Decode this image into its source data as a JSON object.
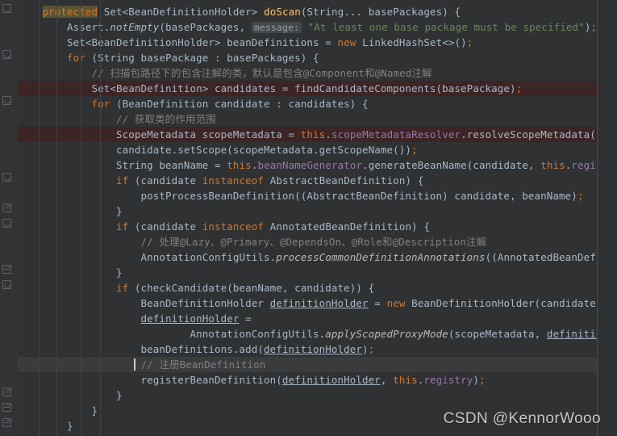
{
  "editor": {
    "theme": "darcula",
    "background": "#2f3133",
    "gutter_background": "#313335",
    "default_text_color": "#a9b7c6",
    "error_line_color": "#3d2425",
    "caret_line_color": "#393b3d",
    "selection_color": "#5b5332",
    "language": "Java",
    "parameter_hint": "message:"
  },
  "watermark": {
    "text": "CSDN @KennorWooo"
  },
  "code": {
    "lines": [
      {
        "id": "line-1",
        "indent": 1,
        "text": "protected Set<BeanDefinitionHolder> doScan(String... basePackages) {",
        "highlight": "none",
        "fold": "collapse"
      },
      {
        "id": "line-2",
        "indent": 2,
        "text": "Assert.notEmpty(basePackages, message: \"At least one base package must be specified\");",
        "highlight": "none",
        "fold": "none"
      },
      {
        "id": "line-3",
        "indent": 2,
        "text": "Set<BeanDefinitionHolder> beanDefinitions = new LinkedHashSet<>();",
        "highlight": "none",
        "fold": "none"
      },
      {
        "id": "line-4",
        "indent": 2,
        "text": "for (String basePackage : basePackages) {",
        "highlight": "none",
        "fold": "collapse"
      },
      {
        "id": "line-5",
        "indent": 3,
        "text": "// 扫描包路径下的包含注解的类，默认是包含@Component和@Named注解",
        "highlight": "none",
        "fold": "none"
      },
      {
        "id": "line-6",
        "indent": 3,
        "text": "Set<BeanDefinition> candidates = findCandidateComponents(basePackage);",
        "highlight": "error",
        "fold": "none"
      },
      {
        "id": "line-7",
        "indent": 3,
        "text": "for (BeanDefinition candidate : candidates) {",
        "highlight": "none",
        "fold": "collapse"
      },
      {
        "id": "line-8",
        "indent": 4,
        "text": "// 获取类的作用范围",
        "highlight": "none",
        "fold": "none"
      },
      {
        "id": "line-9",
        "indent": 4,
        "text": "ScopeMetadata scopeMetadata = this.scopeMetadataResolver.resolveScopeMetadata(candidate);",
        "highlight": "error",
        "fold": "none"
      },
      {
        "id": "line-10",
        "indent": 4,
        "text": "candidate.setScope(scopeMetadata.getScopeName());",
        "highlight": "none",
        "fold": "none"
      },
      {
        "id": "line-11",
        "indent": 4,
        "text": "String beanName = this.beanNameGenerator.generateBeanName(candidate, this.registry);",
        "highlight": "none",
        "fold": "none"
      },
      {
        "id": "line-12",
        "indent": 4,
        "text": "if (candidate instanceof AbstractBeanDefinition) {",
        "highlight": "none",
        "fold": "collapse"
      },
      {
        "id": "line-13",
        "indent": 5,
        "text": "postProcessBeanDefinition((AbstractBeanDefinition) candidate, beanName);",
        "highlight": "none",
        "fold": "none"
      },
      {
        "id": "line-14",
        "indent": 4,
        "text": "}",
        "highlight": "none",
        "fold": "expand"
      },
      {
        "id": "line-15",
        "indent": 4,
        "text": "if (candidate instanceof AnnotatedBeanDefinition) {",
        "highlight": "none",
        "fold": "collapse"
      },
      {
        "id": "line-16",
        "indent": 5,
        "text": "// 处理@Lazy、@Primary、@DependsOn、@Role和@Description注解",
        "highlight": "none",
        "fold": "none"
      },
      {
        "id": "line-17",
        "indent": 5,
        "text": "AnnotationConfigUtils.processCommonDefinitionAnnotations((AnnotatedBeanDefinition) candidate);",
        "highlight": "none",
        "fold": "none"
      },
      {
        "id": "line-18",
        "indent": 4,
        "text": "}",
        "highlight": "none",
        "fold": "expand"
      },
      {
        "id": "line-19",
        "indent": 4,
        "text": "if (checkCandidate(beanName, candidate)) {",
        "highlight": "none",
        "fold": "collapse"
      },
      {
        "id": "line-20",
        "indent": 5,
        "text": "BeanDefinitionHolder definitionHolder = new BeanDefinitionHolder(candidate, beanName);",
        "highlight": "none",
        "fold": "none"
      },
      {
        "id": "line-21",
        "indent": 5,
        "text": "definitionHolder =",
        "highlight": "none",
        "fold": "none"
      },
      {
        "id": "line-22",
        "indent": 7,
        "text": "AnnotationConfigUtils.applyScopedProxyMode(scopeMetadata, definitionHolder, this.registry);",
        "highlight": "none",
        "fold": "none"
      },
      {
        "id": "line-23",
        "indent": 5,
        "text": "beanDefinitions.add(definitionHolder);",
        "highlight": "none",
        "fold": "none"
      },
      {
        "id": "line-24",
        "indent": 5,
        "text": "// 注册BeanDefinition",
        "highlight": "caret",
        "fold": "none"
      },
      {
        "id": "line-25",
        "indent": 5,
        "text": "registerBeanDefinition(definitionHolder, this.registry);",
        "highlight": "none",
        "fold": "none"
      },
      {
        "id": "line-26",
        "indent": 4,
        "text": "}",
        "highlight": "none",
        "fold": "expand"
      },
      {
        "id": "line-27",
        "indent": 3,
        "text": "}",
        "highlight": "none",
        "fold": "expand"
      },
      {
        "id": "line-28",
        "indent": 2,
        "text": "}",
        "highlight": "none",
        "fold": "expand"
      },
      {
        "id": "line-29",
        "indent": 1,
        "text": "}",
        "highlight": "none",
        "fold": "expand"
      }
    ]
  }
}
